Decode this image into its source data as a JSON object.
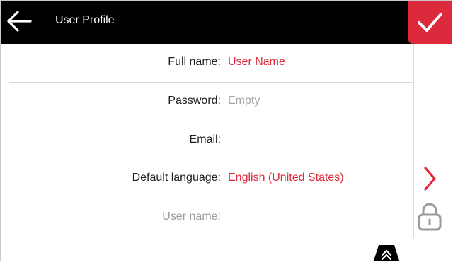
{
  "header": {
    "title": "User Profile",
    "back_icon": "arrow-left-icon",
    "confirm_icon": "checkmark-icon"
  },
  "fields": {
    "full_name": {
      "label": "Full name:",
      "value": "User Name"
    },
    "password": {
      "label": "Password:",
      "placeholder": "Empty"
    },
    "email": {
      "label": "Email:",
      "value": ""
    },
    "default_language": {
      "label": "Default language:",
      "value": "English (United States)"
    },
    "user_name": {
      "label": "User name:",
      "value": ""
    }
  },
  "icons": {
    "language_chevron": "chevron-right-icon",
    "lock": "lock-icon",
    "scroll_top": "double-chevron-up-icon"
  },
  "colors": {
    "accent": "#dc2a3c",
    "header_bg": "#000000",
    "divider": "#d9d9d9"
  }
}
